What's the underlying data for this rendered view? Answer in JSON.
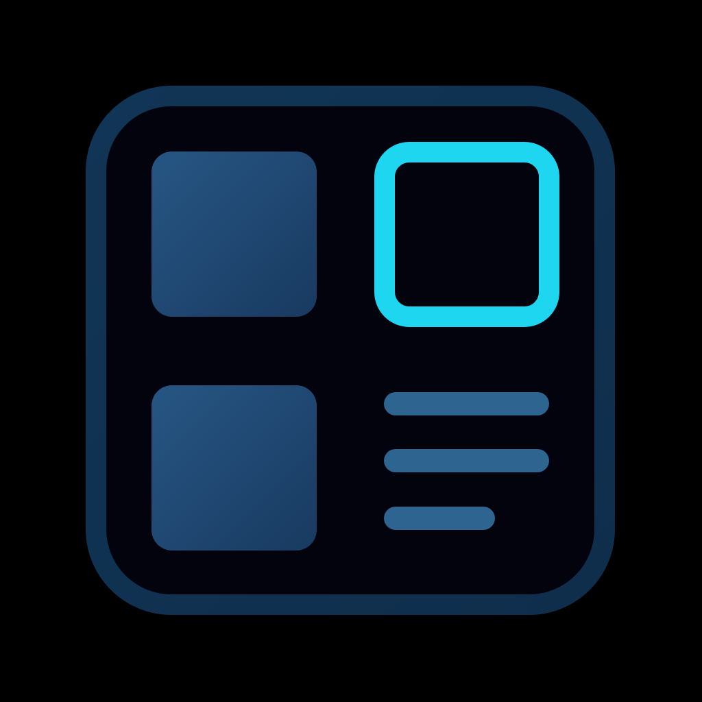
{
  "icon": {
    "name": "widget-dashboard-icon",
    "colors": {
      "background": "#000000",
      "frame_stroke": "#113556",
      "frame_fill": "#02030c",
      "tile_fill_light": "#275684",
      "tile_fill_dark": "#183a60",
      "highlight_stroke": "#1fd6f1",
      "line_fill": "#2e6490"
    },
    "tiles": [
      "tile-top-left",
      "tile-top-right-selected",
      "tile-bottom-left"
    ],
    "text_lines": [
      "text-line-1",
      "text-line-2",
      "text-line-3"
    ]
  }
}
